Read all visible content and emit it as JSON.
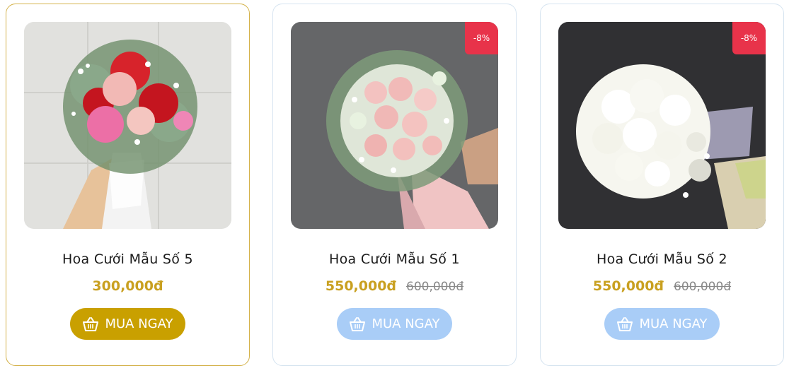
{
  "products": [
    {
      "title": "Hoa Cưới Mẫu Số 5",
      "price": "300,000đ",
      "old_price": "",
      "discount_badge": "",
      "button_label": "MUA NGAY",
      "image_icon": "bridal-bouquet-red-pink-roses"
    },
    {
      "title": "Hoa Cưới Mẫu Số 1",
      "price": "550,000đ",
      "old_price": "600,000đ",
      "discount_badge": "-8%",
      "button_label": "MUA NGAY",
      "image_icon": "bridal-bouquet-pink-roses"
    },
    {
      "title": "Hoa Cưới Mẫu Số 2",
      "price": "550,000đ",
      "old_price": "600,000đ",
      "discount_badge": "-8%",
      "button_label": "MUA NGAY",
      "image_icon": "bridal-bouquet-white-roses"
    }
  ],
  "colors": {
    "price": "#c9a020",
    "badge": "#e8334a",
    "button_active": "#c9a000",
    "button_inactive": "#a9cdf7"
  }
}
